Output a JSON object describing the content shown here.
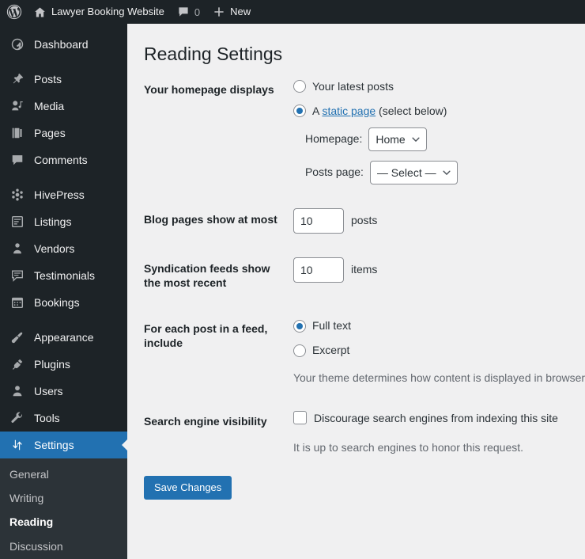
{
  "adminbar": {
    "wp_logo": "wordpress-logo-icon",
    "site_home_icon": "home-icon",
    "site_name": "Lawyer Booking Website",
    "comments_icon": "comment-bubble-icon",
    "comments_count": "0",
    "new_icon": "plus-icon",
    "new_label": "New"
  },
  "sidebar": {
    "items": [
      {
        "label": "Dashboard",
        "icon": "dashboard-gauge-icon",
        "current": false
      },
      {
        "label": "Posts",
        "icon": "pushpin-icon",
        "current": false
      },
      {
        "label": "Media",
        "icon": "media-icon",
        "current": false
      },
      {
        "label": "Pages",
        "icon": "pages-icon",
        "current": false
      },
      {
        "label": "Comments",
        "icon": "comment-bubble-icon",
        "current": false
      },
      {
        "label": "HivePress",
        "icon": "hivepress-icon",
        "current": false
      },
      {
        "label": "Listings",
        "icon": "listings-icon",
        "current": false
      },
      {
        "label": "Vendors",
        "icon": "vendor-user-icon",
        "current": false
      },
      {
        "label": "Testimonials",
        "icon": "testimonials-icon",
        "current": false
      },
      {
        "label": "Bookings",
        "icon": "calendar-icon",
        "current": false
      },
      {
        "label": "Appearance",
        "icon": "paintbrush-icon",
        "current": false
      },
      {
        "label": "Plugins",
        "icon": "plug-icon",
        "current": false
      },
      {
        "label": "Users",
        "icon": "user-icon",
        "current": false
      },
      {
        "label": "Tools",
        "icon": "wrench-icon",
        "current": false
      },
      {
        "label": "Settings",
        "icon": "settings-sliders-icon",
        "current": true
      }
    ],
    "submenu": [
      {
        "label": "General",
        "current": false
      },
      {
        "label": "Writing",
        "current": false
      },
      {
        "label": "Reading",
        "current": true
      },
      {
        "label": "Discussion",
        "current": false
      }
    ]
  },
  "page": {
    "title": "Reading Settings"
  },
  "form": {
    "homepage_displays": {
      "label": "Your homepage displays",
      "options": [
        {
          "text": "Your latest posts",
          "checked": false
        },
        {
          "text_before": "A ",
          "link": "static page",
          "text_after": " (select below)",
          "checked": true
        }
      ],
      "homepage_label": "Homepage:",
      "homepage_value": "Home",
      "posts_page_label": "Posts page:",
      "posts_page_value": "— Select —",
      "chevron": "chevron-down-icon"
    },
    "blog_pages": {
      "label": "Blog pages show at most",
      "value": "10",
      "unit": "posts"
    },
    "syndication": {
      "label": "Syndication feeds show the most recent",
      "value": "10",
      "unit": "items"
    },
    "feed_include": {
      "label": "For each post in a feed, include",
      "options": [
        {
          "text": "Full text",
          "checked": true
        },
        {
          "text": "Excerpt",
          "checked": false
        }
      ],
      "description": "Your theme determines how content is displayed in browsers."
    },
    "search_visibility": {
      "label": "Search engine visibility",
      "checkbox_label": "Discourage search engines from indexing this site",
      "checked": false,
      "description": "It is up to search engines to honor this request."
    },
    "submit_label": "Save Changes"
  },
  "colors": {
    "accent": "#2271b1",
    "sidebar_bg": "#1d2327",
    "submenu_bg": "#2c3338",
    "content_bg": "#f0f0f1"
  }
}
